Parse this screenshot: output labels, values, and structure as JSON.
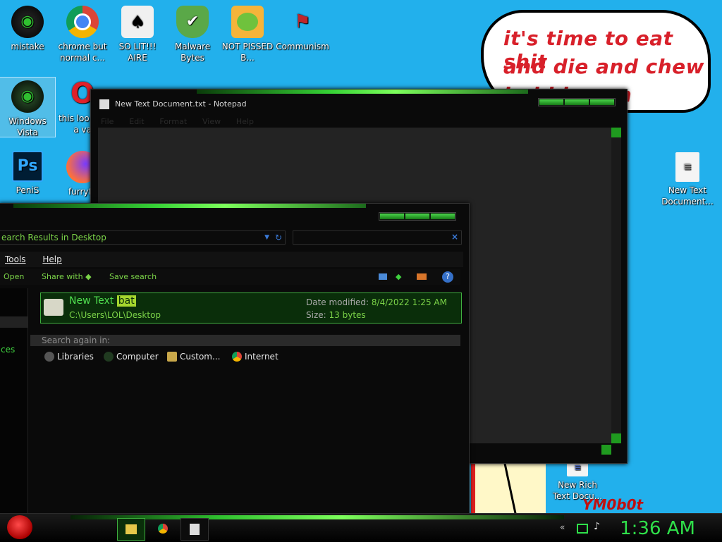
{
  "desktop": {
    "icons": [
      {
        "label": "mistake",
        "name": "mistake"
      },
      {
        "label": "chrome but normal c...",
        "name": "chrome-but-normal"
      },
      {
        "label": "SO LIT!!! AIRE",
        "name": "so-lit-aire"
      },
      {
        "label": "Malware Bytes",
        "name": "malware-bytes"
      },
      {
        "label": "NOT PISSED B...",
        "name": "not-pissed"
      },
      {
        "label": "Communism",
        "name": "communism"
      },
      {
        "label": "Windows Vista",
        "name": "windows-vista"
      },
      {
        "label": "this loo like a va",
        "name": "this-looks-like"
      },
      {
        "label": "PeniS",
        "name": "penis"
      },
      {
        "label": "furryfo",
        "name": "furryfox"
      },
      {
        "label": "New Text Document...",
        "name": "new-text-document"
      },
      {
        "label": "New Rich Text Docu...",
        "name": "new-rich-text-document"
      }
    ],
    "bubble_lines": [
      "it's time to eat shit",
      "and die and chew",
      "bubblegum"
    ],
    "drawing_text": "YM0b0t"
  },
  "notepad": {
    "title": "New Text Document.txt - Notepad",
    "menu": [
      "File",
      "Edit",
      "Format",
      "View",
      "Help"
    ]
  },
  "explorer": {
    "address": "earch Results in Desktop",
    "menu": [
      "Tools",
      "Help"
    ],
    "toolbar": {
      "open": "Open",
      "share": "Share with",
      "save_search": "Save search"
    },
    "left_text": "ces",
    "result": {
      "name_prefix": "New Text",
      "name_highlight": "bat",
      "path": "C:\\Users\\LOL\\Desktop",
      "date_label": "Date modified:",
      "date_value": "8/4/2022 1:25 AM",
      "size_label": "Size:",
      "size_value": "13 bytes"
    },
    "search_again": "Search again in:",
    "locations": [
      "Libraries",
      "Computer",
      "Custom...",
      "Internet"
    ]
  },
  "taskbar": {
    "clock": "1:36 AM"
  },
  "colors": {
    "desktop": "#22b0ec",
    "accent": "#35d135",
    "bubble_text": "#d8202a"
  }
}
